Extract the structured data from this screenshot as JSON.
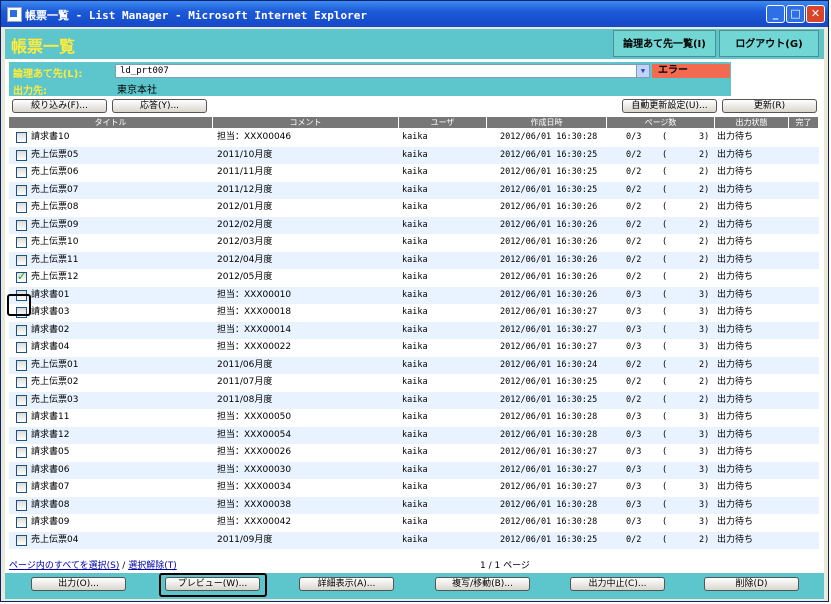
{
  "window": {
    "title": "帳票一覧 - List Manager - Microsoft Internet Explorer"
  },
  "header": {
    "page_title": "帳票一覧",
    "logical_dest_list_label": "論理あて先一覧(I)",
    "logout_label": "ログアウト(G)"
  },
  "dest_panel": {
    "logical_dest_label": "論理あて先(L):",
    "logical_dest_value": "ld_prt007",
    "error_label": "エラー",
    "output_dest_label": "出力先:",
    "output_dest_value": "東京本社"
  },
  "toolbar": {
    "filter_label": "絞り込み(F)...",
    "reply_label": "応答(Y)...",
    "auto_refresh_label": "自動更新設定(U)...",
    "refresh_label": "更新(R)"
  },
  "table": {
    "headers": [
      "タイトル",
      "コメント",
      "ユーザ",
      "作成日時",
      "ページ数",
      "出力状態",
      "完了"
    ],
    "rows": [
      {
        "title": "請求書10",
        "comment": "担当：XXX00046",
        "user": "kaika",
        "date": "2012/06/01 16:30:28",
        "pages": "0/3",
        "copies": "3)",
        "status": "出力待ち",
        "checked": false
      },
      {
        "title": "売上伝票05",
        "comment": "2011/10月度",
        "user": "kaika",
        "date": "2012/06/01 16:30:25",
        "pages": "0/2",
        "copies": "2)",
        "status": "出力待ち",
        "checked": false
      },
      {
        "title": "売上伝票06",
        "comment": "2011/11月度",
        "user": "kaika",
        "date": "2012/06/01 16:30:25",
        "pages": "0/2",
        "copies": "2)",
        "status": "出力待ち",
        "checked": false
      },
      {
        "title": "売上伝票07",
        "comment": "2011/12月度",
        "user": "kaika",
        "date": "2012/06/01 16:30:25",
        "pages": "0/2",
        "copies": "2)",
        "status": "出力待ち",
        "checked": false
      },
      {
        "title": "売上伝票08",
        "comment": "2012/01月度",
        "user": "kaika",
        "date": "2012/06/01 16:30:26",
        "pages": "0/2",
        "copies": "2)",
        "status": "出力待ち",
        "checked": false
      },
      {
        "title": "売上伝票09",
        "comment": "2012/02月度",
        "user": "kaika",
        "date": "2012/06/01 16:30:26",
        "pages": "0/2",
        "copies": "2)",
        "status": "出力待ち",
        "checked": false
      },
      {
        "title": "売上伝票10",
        "comment": "2012/03月度",
        "user": "kaika",
        "date": "2012/06/01 16:30:26",
        "pages": "0/2",
        "copies": "2)",
        "status": "出力待ち",
        "checked": false
      },
      {
        "title": "売上伝票11",
        "comment": "2012/04月度",
        "user": "kaika",
        "date": "2012/06/01 16:30:26",
        "pages": "0/2",
        "copies": "2)",
        "status": "出力待ち",
        "checked": false
      },
      {
        "title": "売上伝票12",
        "comment": "2012/05月度",
        "user": "kaika",
        "date": "2012/06/01 16:30:26",
        "pages": "0/2",
        "copies": "2)",
        "status": "出力待ち",
        "checked": true
      },
      {
        "title": "請求書01",
        "comment": "担当：XXX00010",
        "user": "kaika",
        "date": "2012/06/01 16:30:26",
        "pages": "0/3",
        "copies": "3)",
        "status": "出力待ち",
        "checked": false
      },
      {
        "title": "請求書03",
        "comment": "担当：XXX00018",
        "user": "kaika",
        "date": "2012/06/01 16:30:27",
        "pages": "0/3",
        "copies": "3)",
        "status": "出力待ち",
        "checked": false
      },
      {
        "title": "請求書02",
        "comment": "担当：XXX00014",
        "user": "kaika",
        "date": "2012/06/01 16:30:27",
        "pages": "0/3",
        "copies": "3)",
        "status": "出力待ち",
        "checked": false
      },
      {
        "title": "請求書04",
        "comment": "担当：XXX00022",
        "user": "kaika",
        "date": "2012/06/01 16:30:27",
        "pages": "0/3",
        "copies": "3)",
        "status": "出力待ち",
        "checked": false
      },
      {
        "title": "売上伝票01",
        "comment": "2011/06月度",
        "user": "kaika",
        "date": "2012/06/01 16:30:24",
        "pages": "0/2",
        "copies": "2)",
        "status": "出力待ち",
        "checked": false
      },
      {
        "title": "売上伝票02",
        "comment": "2011/07月度",
        "user": "kaika",
        "date": "2012/06/01 16:30:25",
        "pages": "0/2",
        "copies": "2)",
        "status": "出力待ち",
        "checked": false
      },
      {
        "title": "売上伝票03",
        "comment": "2011/08月度",
        "user": "kaika",
        "date": "2012/06/01 16:30:25",
        "pages": "0/2",
        "copies": "2)",
        "status": "出力待ち",
        "checked": false
      },
      {
        "title": "請求書11",
        "comment": "担当：XXX00050",
        "user": "kaika",
        "date": "2012/06/01 16:30:28",
        "pages": "0/3",
        "copies": "3)",
        "status": "出力待ち",
        "checked": false
      },
      {
        "title": "請求書12",
        "comment": "担当：XXX00054",
        "user": "kaika",
        "date": "2012/06/01 16:30:28",
        "pages": "0/3",
        "copies": "3)",
        "status": "出力待ち",
        "checked": false
      },
      {
        "title": "請求書05",
        "comment": "担当：XXX00026",
        "user": "kaika",
        "date": "2012/06/01 16:30:27",
        "pages": "0/3",
        "copies": "3)",
        "status": "出力待ち",
        "checked": false
      },
      {
        "title": "請求書06",
        "comment": "担当：XXX00030",
        "user": "kaika",
        "date": "2012/06/01 16:30:27",
        "pages": "0/3",
        "copies": "3)",
        "status": "出力待ち",
        "checked": false
      },
      {
        "title": "請求書07",
        "comment": "担当：XXX00034",
        "user": "kaika",
        "date": "2012/06/01 16:30:27",
        "pages": "0/3",
        "copies": "3)",
        "status": "出力待ち",
        "checked": false
      },
      {
        "title": "請求書08",
        "comment": "担当：XXX00038",
        "user": "kaika",
        "date": "2012/06/01 16:30:28",
        "pages": "0/3",
        "copies": "3)",
        "status": "出力待ち",
        "checked": false
      },
      {
        "title": "請求書09",
        "comment": "担当：XXX00042",
        "user": "kaika",
        "date": "2012/06/01 16:30:28",
        "pages": "0/3",
        "copies": "3)",
        "status": "出力待ち",
        "checked": false
      },
      {
        "title": "売上伝票04",
        "comment": "2011/09月度",
        "user": "kaika",
        "date": "2012/06/01 16:30:25",
        "pages": "0/2",
        "copies": "2)",
        "status": "出力待ち",
        "checked": false
      }
    ]
  },
  "footer": {
    "select_all_label": "ページ内のすべてを選択(S)",
    "separator": "/",
    "deselect_label": "選択解除(T)",
    "pager_text": "1 / 1 ページ"
  },
  "actions": {
    "output": "出力(O)...",
    "preview": "プレビュー(W)...",
    "details": "詳細表示(A)...",
    "copy_move": "複写/移動(B)...",
    "cancel_output": "出力中止(C)...",
    "delete": "削除(D)"
  }
}
